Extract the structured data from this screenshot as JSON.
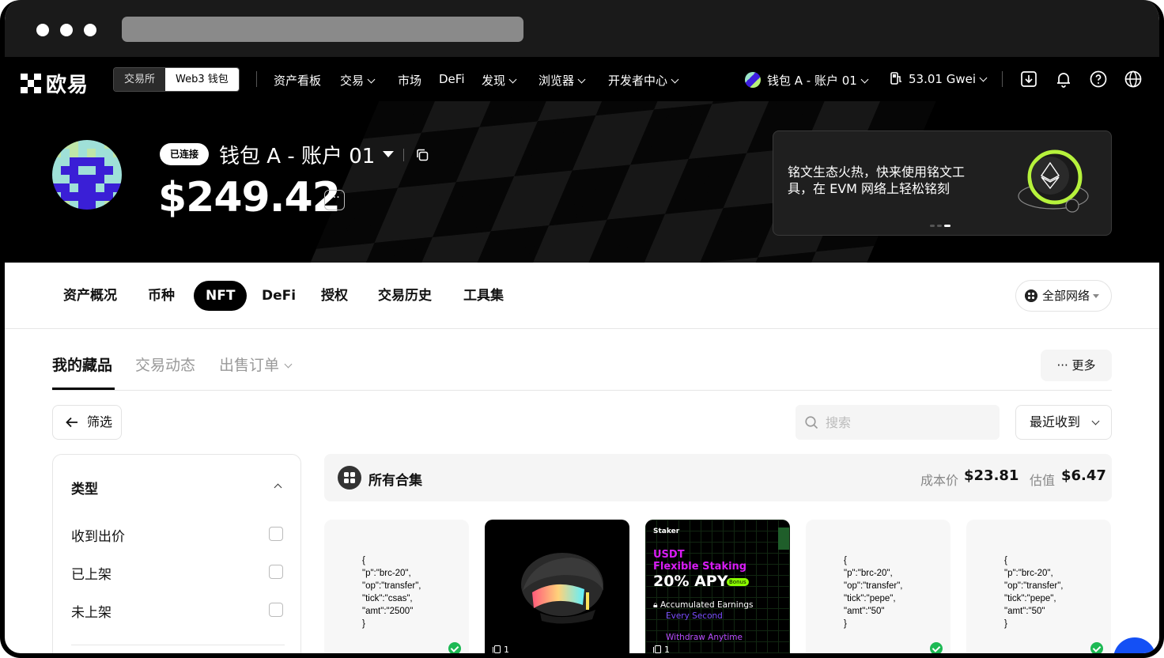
{
  "nav": {
    "brand": "欧易",
    "segment": [
      "交易所",
      "Web3 钱包"
    ],
    "menu": [
      "资产看板",
      "交易",
      "市场",
      "DeFi",
      "发现",
      "浏览器",
      "开发者中心"
    ],
    "account": "钱包 A - 账户 01",
    "gas": "53.01 Gwei"
  },
  "hero": {
    "badge": "已连接",
    "wallet_name": "钱包 A - 账户 01",
    "balance": "$249.42",
    "more": "···",
    "promo_text": "铭文生态火热，快来使用铭文工具，在 EVM 网络上轻松铭刻"
  },
  "tabs": {
    "items": [
      "资产概况",
      "币种",
      "NFT",
      "DeFi",
      "授权",
      "交易历史",
      "工具集"
    ],
    "active": "NFT",
    "network": "全部网络"
  },
  "subtabs": {
    "items": [
      "我的藏品",
      "交易动态",
      "出售订单"
    ],
    "more": "··· 更多"
  },
  "toolbar": {
    "filter": "筛选",
    "search_placeholder": "搜索",
    "sort": "最近收到"
  },
  "sidebar": {
    "title": "类型",
    "items": [
      "收到出价",
      "已上架",
      "未上架"
    ]
  },
  "collection": {
    "title": "所有合集",
    "cost_label": "成本价",
    "cost_value": "$23.81",
    "value_label": "估值",
    "value_value": "$6.47"
  },
  "cards": [
    {
      "text": "{\n\"p\":\"brc-20\",\n\"op\":\"transfer\",\n\"tick\":\"csas\",\n\"amt\":\"2500\"\n}"
    },
    {
      "count": "1"
    },
    {
      "count": "1",
      "logo": "Staker",
      "line1": "USDT",
      "line2": "Flexible Staking",
      "apy": "20% APY",
      "bonus": "Bonus",
      "earn": "Accumulated Earnings",
      "sec": "Every Second",
      "withdraw": "Withdraw Anytime"
    },
    {
      "text": "{\n\"p\":\"brc-20\",\n\"op\":\"transfer\",\n\"tick\":\"pepe\",\n\"amt\":\"50\"\n}"
    },
    {
      "text": "{\n\"p\":\"brc-20\",\n\"op\":\"transfer\",\n\"tick\":\"pepe\",\n\"amt\":\"50\"\n}"
    }
  ]
}
